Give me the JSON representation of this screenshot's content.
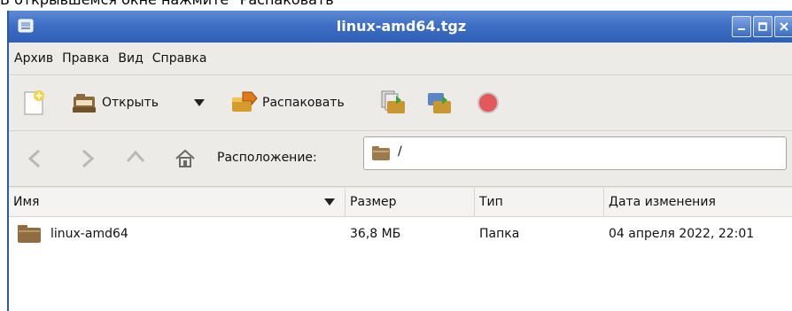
{
  "caption": {
    "text": "В открывшемся окне нажмите \"Распаковать\""
  },
  "window": {
    "title": "linux-amd64.tgz",
    "controls": {
      "minimize_icon": "minimize-icon",
      "maximize_icon": "maximize-icon",
      "close_icon": "close-icon"
    }
  },
  "menu": {
    "items": [
      "Архив",
      "Правка",
      "Вид",
      "Справка"
    ]
  },
  "toolbar": {
    "open_label": "Открыть",
    "extract_label": "Распаковать"
  },
  "location": {
    "label": "Расположение:",
    "path": "/"
  },
  "table": {
    "headers": [
      "Имя",
      "Размер",
      "Тип",
      "Дата изменения"
    ],
    "rows": [
      {
        "name": "linux-amd64",
        "size": "36,8 МБ",
        "type": "Папка",
        "modified": "04 апреля 2022, 22:01"
      }
    ]
  },
  "colors": {
    "title_bar": "#3f6fc4",
    "window_bg": "#e9e7e3",
    "folder": "#9b7b4c",
    "stop": "#d9383c"
  }
}
